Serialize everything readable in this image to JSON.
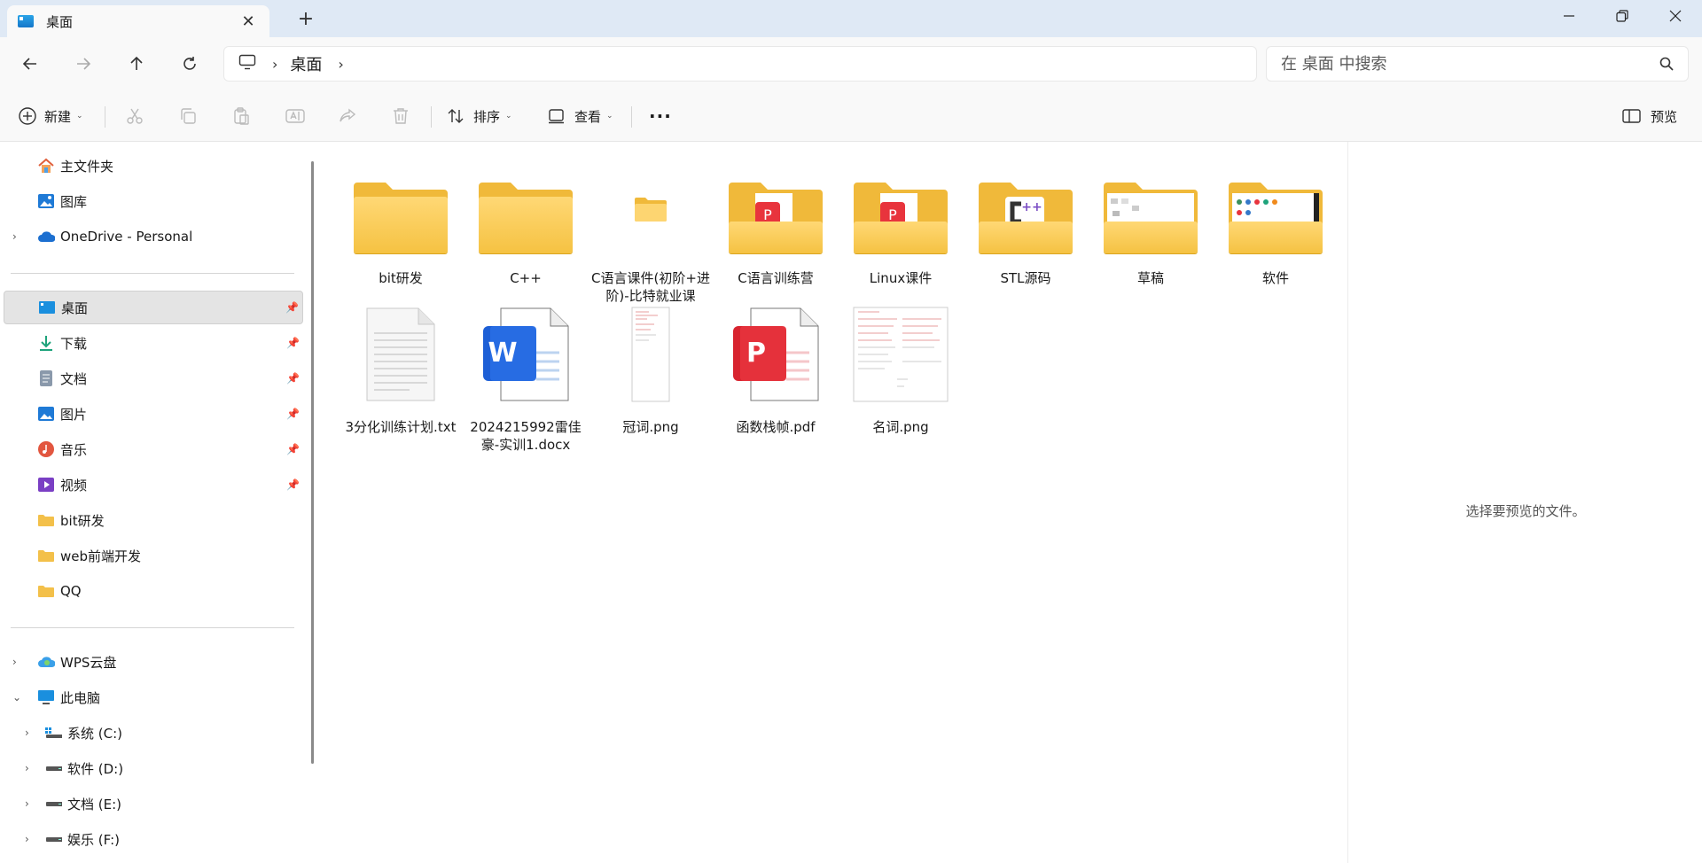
{
  "window": {
    "tab_title": "桌面",
    "new_tab_symbol": "+"
  },
  "address": {
    "crumbs": [
      "桌面"
    ],
    "search_placeholder": "在 桌面 中搜索"
  },
  "toolbar": {
    "new_label": "新建",
    "sort_label": "排序",
    "view_label": "查看",
    "more_label": "···",
    "preview_label": "预览"
  },
  "sidebar": {
    "quick": [
      {
        "label": "主文件夹"
      },
      {
        "label": "图库"
      },
      {
        "label": "OneDrive - Personal"
      }
    ],
    "pinned": [
      {
        "label": "桌面"
      },
      {
        "label": "下载"
      },
      {
        "label": "文档"
      },
      {
        "label": "图片"
      },
      {
        "label": "音乐"
      },
      {
        "label": "视频"
      },
      {
        "label": "bit研发"
      },
      {
        "label": "web前端开发"
      },
      {
        "label": "QQ"
      }
    ],
    "locations": [
      {
        "label": "WPS云盘"
      },
      {
        "label": "此电脑"
      },
      {
        "label": "系统 (C:)"
      },
      {
        "label": "软件 (D:)"
      },
      {
        "label": "文档 (E:)"
      },
      {
        "label": "娱乐 (F:)"
      }
    ]
  },
  "files": [
    {
      "name": "bit研发",
      "kind": "folder"
    },
    {
      "name": "C++",
      "kind": "folder"
    },
    {
      "name": "C语言课件(初阶+进阶)-比特就业课",
      "kind": "folder-small"
    },
    {
      "name": "C语言训练营",
      "kind": "folder-pdf"
    },
    {
      "name": "Linux课件",
      "kind": "folder-pdf"
    },
    {
      "name": "STL源码",
      "kind": "folder-cpp"
    },
    {
      "name": "草稿",
      "kind": "folder-img"
    },
    {
      "name": "软件",
      "kind": "folder-img2"
    },
    {
      "name": "3分化训练计划.txt",
      "kind": "txt"
    },
    {
      "name": "2024215992雷佳豪-实训1.docx",
      "kind": "docx"
    },
    {
      "name": "冠词.png",
      "kind": "png-tall"
    },
    {
      "name": "函数栈帧.pdf",
      "kind": "pdf"
    },
    {
      "name": "名词.png",
      "kind": "png-wide"
    }
  ],
  "preview": {
    "message": "选择要预览的文件。"
  }
}
